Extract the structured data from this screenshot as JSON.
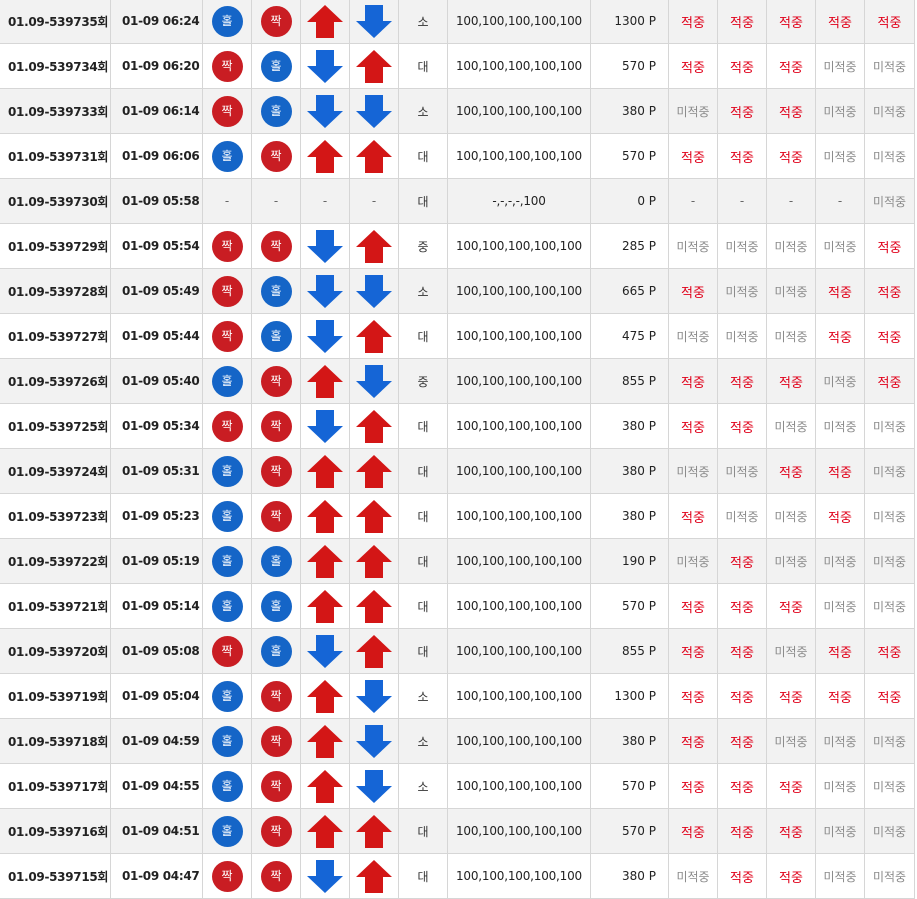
{
  "colors": {
    "odd_ball": "#1565c7",
    "even_ball": "#c91d23",
    "arrow_up": "#d31616",
    "arrow_down": "#1565d6",
    "hit_text": "#e0001a",
    "miss_text": "#8a8a8a"
  },
  "rows": [
    {
      "round": "01.09-539735회",
      "time": "01-09 06:24",
      "b1": {
        "label": "홀",
        "type": "odd"
      },
      "b2": {
        "label": "짝",
        "type": "even"
      },
      "a1": "up",
      "a2": "down",
      "size": "소",
      "picks": "100,100,100,100,100",
      "points": "1300 P",
      "r": [
        "적중",
        "적중",
        "적중",
        "적중",
        "적중"
      ]
    },
    {
      "round": "01.09-539734회",
      "time": "01-09 06:20",
      "b1": {
        "label": "짝",
        "type": "even"
      },
      "b2": {
        "label": "홀",
        "type": "odd"
      },
      "a1": "down",
      "a2": "up",
      "size": "대",
      "picks": "100,100,100,100,100",
      "points": "570 P",
      "r": [
        "적중",
        "적중",
        "적중",
        "미적중",
        "미적중"
      ]
    },
    {
      "round": "01.09-539733회",
      "time": "01-09 06:14",
      "b1": {
        "label": "짝",
        "type": "even"
      },
      "b2": {
        "label": "홀",
        "type": "odd"
      },
      "a1": "down",
      "a2": "down",
      "size": "소",
      "picks": "100,100,100,100,100",
      "points": "380 P",
      "r": [
        "미적중",
        "적중",
        "적중",
        "미적중",
        "미적중"
      ]
    },
    {
      "round": "01.09-539731회",
      "time": "01-09 06:06",
      "b1": {
        "label": "홀",
        "type": "odd"
      },
      "b2": {
        "label": "짝",
        "type": "even"
      },
      "a1": "up",
      "a2": "up",
      "size": "대",
      "picks": "100,100,100,100,100",
      "points": "570 P",
      "r": [
        "적중",
        "적중",
        "적중",
        "미적중",
        "미적중"
      ]
    },
    {
      "round": "01.09-539730회",
      "time": "01-09 05:58",
      "b1": null,
      "b2": null,
      "a1": null,
      "a2": null,
      "size": "대",
      "picks": "-,-,-,-,100",
      "points": "0 P",
      "r": [
        "-",
        "-",
        "-",
        "-",
        "미적중"
      ]
    },
    {
      "round": "01.09-539729회",
      "time": "01-09 05:54",
      "b1": {
        "label": "짝",
        "type": "even"
      },
      "b2": {
        "label": "짝",
        "type": "even"
      },
      "a1": "down",
      "a2": "up",
      "size": "중",
      "picks": "100,100,100,100,100",
      "points": "285 P",
      "r": [
        "미적중",
        "미적중",
        "미적중",
        "미적중",
        "적중"
      ]
    },
    {
      "round": "01.09-539728회",
      "time": "01-09 05:49",
      "b1": {
        "label": "짝",
        "type": "even"
      },
      "b2": {
        "label": "홀",
        "type": "odd"
      },
      "a1": "down",
      "a2": "down",
      "size": "소",
      "picks": "100,100,100,100,100",
      "points": "665 P",
      "r": [
        "적중",
        "미적중",
        "미적중",
        "적중",
        "적중"
      ]
    },
    {
      "round": "01.09-539727회",
      "time": "01-09 05:44",
      "b1": {
        "label": "짝",
        "type": "even"
      },
      "b2": {
        "label": "홀",
        "type": "odd"
      },
      "a1": "down",
      "a2": "up",
      "size": "대",
      "picks": "100,100,100,100,100",
      "points": "475 P",
      "r": [
        "미적중",
        "미적중",
        "미적중",
        "적중",
        "적중"
      ]
    },
    {
      "round": "01.09-539726회",
      "time": "01-09 05:40",
      "b1": {
        "label": "홀",
        "type": "odd"
      },
      "b2": {
        "label": "짝",
        "type": "even"
      },
      "a1": "up",
      "a2": "down",
      "size": "중",
      "picks": "100,100,100,100,100",
      "points": "855 P",
      "r": [
        "적중",
        "적중",
        "적중",
        "미적중",
        "적중"
      ]
    },
    {
      "round": "01.09-539725회",
      "time": "01-09 05:34",
      "b1": {
        "label": "짝",
        "type": "even"
      },
      "b2": {
        "label": "짝",
        "type": "even"
      },
      "a1": "down",
      "a2": "up",
      "size": "대",
      "picks": "100,100,100,100,100",
      "points": "380 P",
      "r": [
        "적중",
        "적중",
        "미적중",
        "미적중",
        "미적중"
      ]
    },
    {
      "round": "01.09-539724회",
      "time": "01-09 05:31",
      "b1": {
        "label": "홀",
        "type": "odd"
      },
      "b2": {
        "label": "짝",
        "type": "even"
      },
      "a1": "up",
      "a2": "up",
      "size": "대",
      "picks": "100,100,100,100,100",
      "points": "380 P",
      "r": [
        "미적중",
        "미적중",
        "적중",
        "적중",
        "미적중"
      ]
    },
    {
      "round": "01.09-539723회",
      "time": "01-09 05:23",
      "b1": {
        "label": "홀",
        "type": "odd"
      },
      "b2": {
        "label": "짝",
        "type": "even"
      },
      "a1": "up",
      "a2": "up",
      "size": "대",
      "picks": "100,100,100,100,100",
      "points": "380 P",
      "r": [
        "적중",
        "미적중",
        "미적중",
        "적중",
        "미적중"
      ]
    },
    {
      "round": "01.09-539722회",
      "time": "01-09 05:19",
      "b1": {
        "label": "홀",
        "type": "odd"
      },
      "b2": {
        "label": "홀",
        "type": "odd"
      },
      "a1": "up",
      "a2": "up",
      "size": "대",
      "picks": "100,100,100,100,100",
      "points": "190 P",
      "r": [
        "미적중",
        "적중",
        "미적중",
        "미적중",
        "미적중"
      ]
    },
    {
      "round": "01.09-539721회",
      "time": "01-09 05:14",
      "b1": {
        "label": "홀",
        "type": "odd"
      },
      "b2": {
        "label": "홀",
        "type": "odd"
      },
      "a1": "up",
      "a2": "up",
      "size": "대",
      "picks": "100,100,100,100,100",
      "points": "570 P",
      "r": [
        "적중",
        "적중",
        "적중",
        "미적중",
        "미적중"
      ]
    },
    {
      "round": "01.09-539720회",
      "time": "01-09 05:08",
      "b1": {
        "label": "짝",
        "type": "even"
      },
      "b2": {
        "label": "홀",
        "type": "odd"
      },
      "a1": "down",
      "a2": "up",
      "size": "대",
      "picks": "100,100,100,100,100",
      "points": "855 P",
      "r": [
        "적중",
        "적중",
        "미적중",
        "적중",
        "적중"
      ]
    },
    {
      "round": "01.09-539719회",
      "time": "01-09 05:04",
      "b1": {
        "label": "홀",
        "type": "odd"
      },
      "b2": {
        "label": "짝",
        "type": "even"
      },
      "a1": "up",
      "a2": "down",
      "size": "소",
      "picks": "100,100,100,100,100",
      "points": "1300 P",
      "r": [
        "적중",
        "적중",
        "적중",
        "적중",
        "적중"
      ]
    },
    {
      "round": "01.09-539718회",
      "time": "01-09 04:59",
      "b1": {
        "label": "홀",
        "type": "odd"
      },
      "b2": {
        "label": "짝",
        "type": "even"
      },
      "a1": "up",
      "a2": "down",
      "size": "소",
      "picks": "100,100,100,100,100",
      "points": "380 P",
      "r": [
        "적중",
        "적중",
        "미적중",
        "미적중",
        "미적중"
      ]
    },
    {
      "round": "01.09-539717회",
      "time": "01-09 04:55",
      "b1": {
        "label": "홀",
        "type": "odd"
      },
      "b2": {
        "label": "짝",
        "type": "even"
      },
      "a1": "up",
      "a2": "down",
      "size": "소",
      "picks": "100,100,100,100,100",
      "points": "570 P",
      "r": [
        "적중",
        "적중",
        "적중",
        "미적중",
        "미적중"
      ]
    },
    {
      "round": "01.09-539716회",
      "time": "01-09 04:51",
      "b1": {
        "label": "홀",
        "type": "odd"
      },
      "b2": {
        "label": "짝",
        "type": "even"
      },
      "a1": "up",
      "a2": "up",
      "size": "대",
      "picks": "100,100,100,100,100",
      "points": "570 P",
      "r": [
        "적중",
        "적중",
        "적중",
        "미적중",
        "미적중"
      ]
    },
    {
      "round": "01.09-539715회",
      "time": "01-09 04:47",
      "b1": {
        "label": "짝",
        "type": "even"
      },
      "b2": {
        "label": "짝",
        "type": "even"
      },
      "a1": "down",
      "a2": "up",
      "size": "대",
      "picks": "100,100,100,100,100",
      "points": "380 P",
      "r": [
        "미적중",
        "적중",
        "적중",
        "미적중",
        "미적중"
      ]
    }
  ]
}
